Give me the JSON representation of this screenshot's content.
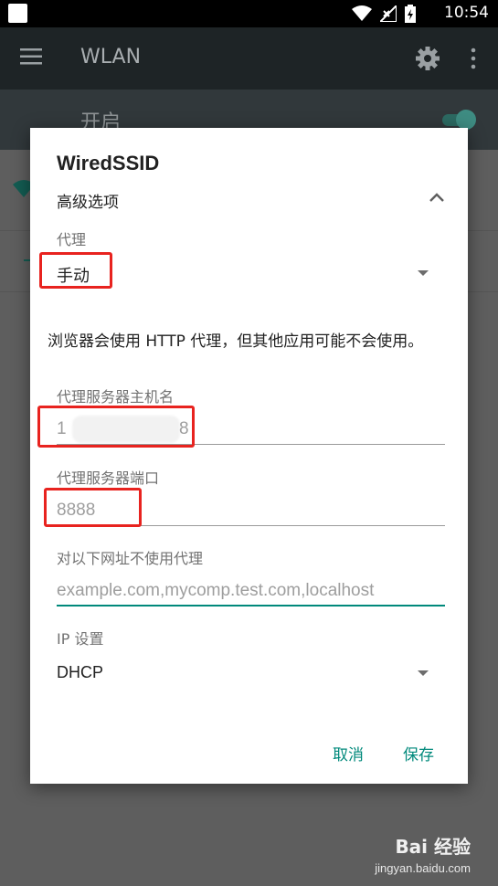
{
  "status_bar": {
    "time": "10:54",
    "icons": [
      "wifi-icon",
      "no-signal-icon",
      "battery-charging-icon"
    ]
  },
  "app_bar": {
    "title": "WLAN",
    "icons": [
      "menu-icon",
      "settings-gear-icon",
      "more-vert-icon"
    ]
  },
  "wifi_switch": {
    "label": "开启",
    "state": "on"
  },
  "dialog": {
    "title": "WiredSSID",
    "advanced_options_label": "高级选项",
    "proxy": {
      "label": "代理",
      "selected": "手动"
    },
    "proxy_hint": "浏览器会使用 HTTP 代理，但其他应用可能不会使用。",
    "proxy_host": {
      "label": "代理服务器主机名",
      "value_start": "1",
      "value_end": "8"
    },
    "proxy_port": {
      "label": "代理服务器端口",
      "value": "8888"
    },
    "bypass": {
      "label": "对以下网址不使用代理",
      "placeholder": "example.com,mycomp.test.com,localhost"
    },
    "ip_settings": {
      "label": "IP 设置",
      "selected": "DHCP"
    },
    "buttons": {
      "cancel": "取消",
      "save": "保存"
    }
  },
  "colors": {
    "accent": "#00897b",
    "highlight_box": "#e8231f"
  },
  "watermark": {
    "text_big": "Bai 经验",
    "url": "jingyan.baidu.com"
  }
}
